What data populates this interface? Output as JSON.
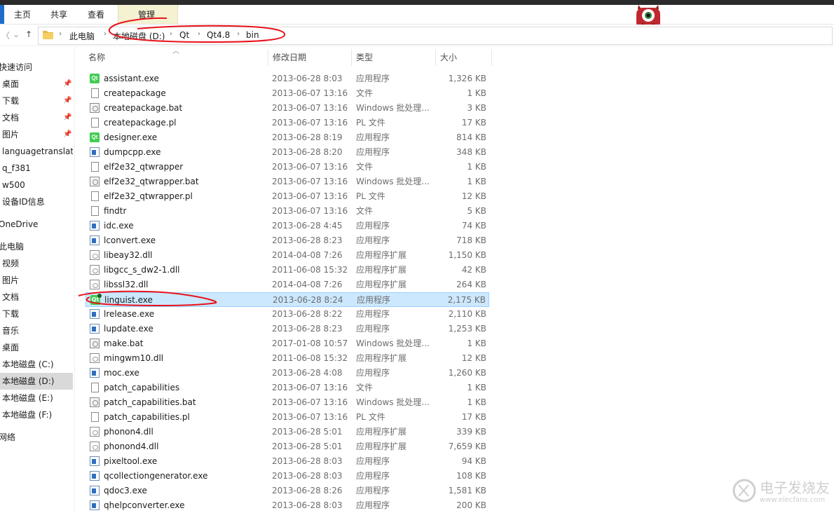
{
  "ribbon": {
    "tabs": [
      "主页",
      "共享",
      "查看"
    ],
    "context_tab": "管理"
  },
  "address": {
    "crumbs": [
      "此电脑",
      "本地磁盘 (D:)",
      "Qt",
      "Qt4.8",
      "bin"
    ]
  },
  "sidebar": {
    "items": [
      {
        "label": "快速访问",
        "pinned": false
      },
      {
        "label": "桌面",
        "pinned": true
      },
      {
        "label": "下载",
        "pinned": true
      },
      {
        "label": "文档",
        "pinned": true
      },
      {
        "label": "图片",
        "pinned": true
      },
      {
        "label": "languagetranslatc",
        "pinned": false
      },
      {
        "label": "q_f381",
        "pinned": false
      },
      {
        "label": "w500",
        "pinned": false
      },
      {
        "label": "设备ID信息",
        "pinned": false
      },
      {
        "label": "OneDrive",
        "pinned": false
      },
      {
        "label": "此电脑",
        "pinned": false
      },
      {
        "label": "视频",
        "pinned": false
      },
      {
        "label": "图片",
        "pinned": false
      },
      {
        "label": "文档",
        "pinned": false
      },
      {
        "label": "下载",
        "pinned": false
      },
      {
        "label": "音乐",
        "pinned": false
      },
      {
        "label": "桌面",
        "pinned": false
      },
      {
        "label": "本地磁盘 (C:)",
        "pinned": false
      },
      {
        "label": "本地磁盘 (D:)",
        "pinned": false,
        "selected": true
      },
      {
        "label": "本地磁盘 (E:)",
        "pinned": false
      },
      {
        "label": "本地磁盘 (F:)",
        "pinned": false
      },
      {
        "label": "网络",
        "pinned": false
      }
    ]
  },
  "columns": {
    "name": "名称",
    "date": "修改日期",
    "type": "类型",
    "size": "大小"
  },
  "files": [
    {
      "name": "assistant.exe",
      "date": "2013-06-28 8:03",
      "type": "应用程序",
      "size": "1,326 KB",
      "icon": "qt-icon"
    },
    {
      "name": "createpackage",
      "date": "2013-06-07 13:16",
      "type": "文件",
      "size": "1 KB",
      "icon": "file-icon"
    },
    {
      "name": "createpackage.bat",
      "date": "2013-06-07 13:16",
      "type": "Windows 批处理...",
      "size": "3 KB",
      "icon": "bat-icon"
    },
    {
      "name": "createpackage.pl",
      "date": "2013-06-07 13:16",
      "type": "PL 文件",
      "size": "17 KB",
      "icon": "file-icon"
    },
    {
      "name": "designer.exe",
      "date": "2013-06-28 8:19",
      "type": "应用程序",
      "size": "814 KB",
      "icon": "qt-icon"
    },
    {
      "name": "dumpcpp.exe",
      "date": "2013-06-28 8:20",
      "type": "应用程序",
      "size": "348 KB",
      "icon": "exe-icon"
    },
    {
      "name": "elf2e32_qtwrapper",
      "date": "2013-06-07 13:16",
      "type": "文件",
      "size": "1 KB",
      "icon": "file-icon"
    },
    {
      "name": "elf2e32_qtwrapper.bat",
      "date": "2013-06-07 13:16",
      "type": "Windows 批处理...",
      "size": "1 KB",
      "icon": "bat-icon"
    },
    {
      "name": "elf2e32_qtwrapper.pl",
      "date": "2013-06-07 13:16",
      "type": "PL 文件",
      "size": "12 KB",
      "icon": "file-icon"
    },
    {
      "name": "findtr",
      "date": "2013-06-07 13:16",
      "type": "文件",
      "size": "5 KB",
      "icon": "file-icon"
    },
    {
      "name": "idc.exe",
      "date": "2013-06-28 4:45",
      "type": "应用程序",
      "size": "74 KB",
      "icon": "exe-icon"
    },
    {
      "name": "lconvert.exe",
      "date": "2013-06-28 8:23",
      "type": "应用程序",
      "size": "718 KB",
      "icon": "exe-icon"
    },
    {
      "name": "libeay32.dll",
      "date": "2014-04-08 7:26",
      "type": "应用程序扩展",
      "size": "1,150 KB",
      "icon": "dll-icon"
    },
    {
      "name": "libgcc_s_dw2-1.dll",
      "date": "2011-06-08 15:32",
      "type": "应用程序扩展",
      "size": "42 KB",
      "icon": "dll-icon"
    },
    {
      "name": "libssl32.dll",
      "date": "2014-04-08 7:26",
      "type": "应用程序扩展",
      "size": "264 KB",
      "icon": "dll-icon"
    },
    {
      "name": "linguist.exe",
      "date": "2013-06-28 8:24",
      "type": "应用程序",
      "size": "2,175 KB",
      "icon": "linguist-icon",
      "selected": true
    },
    {
      "name": "lrelease.exe",
      "date": "2013-06-28 8:22",
      "type": "应用程序",
      "size": "2,110 KB",
      "icon": "exe-icon"
    },
    {
      "name": "lupdate.exe",
      "date": "2013-06-28 8:23",
      "type": "应用程序",
      "size": "1,253 KB",
      "icon": "exe-icon"
    },
    {
      "name": "make.bat",
      "date": "2017-01-08 10:57",
      "type": "Windows 批处理...",
      "size": "1 KB",
      "icon": "bat-icon"
    },
    {
      "name": "mingwm10.dll",
      "date": "2011-06-08 15:32",
      "type": "应用程序扩展",
      "size": "12 KB",
      "icon": "dll-icon"
    },
    {
      "name": "moc.exe",
      "date": "2013-06-28 4:08",
      "type": "应用程序",
      "size": "1,260 KB",
      "icon": "exe-icon"
    },
    {
      "name": "patch_capabilities",
      "date": "2013-06-07 13:16",
      "type": "文件",
      "size": "1 KB",
      "icon": "file-icon"
    },
    {
      "name": "patch_capabilities.bat",
      "date": "2013-06-07 13:16",
      "type": "Windows 批处理...",
      "size": "1 KB",
      "icon": "bat-icon"
    },
    {
      "name": "patch_capabilities.pl",
      "date": "2013-06-07 13:16",
      "type": "PL 文件",
      "size": "17 KB",
      "icon": "file-icon"
    },
    {
      "name": "phonon4.dll",
      "date": "2013-06-28 5:01",
      "type": "应用程序扩展",
      "size": "339 KB",
      "icon": "dll-icon"
    },
    {
      "name": "phonond4.dll",
      "date": "2013-06-28 5:01",
      "type": "应用程序扩展",
      "size": "7,659 KB",
      "icon": "dll-icon"
    },
    {
      "name": "pixeltool.exe",
      "date": "2013-06-28 8:03",
      "type": "应用程序",
      "size": "94 KB",
      "icon": "exe-icon"
    },
    {
      "name": "qcollectiongenerator.exe",
      "date": "2013-06-28 8:03",
      "type": "应用程序",
      "size": "108 KB",
      "icon": "exe-icon"
    },
    {
      "name": "qdoc3.exe",
      "date": "2013-06-28 8:26",
      "type": "应用程序",
      "size": "1,581 KB",
      "icon": "exe-icon"
    },
    {
      "name": "qhelpconverter.exe",
      "date": "2013-06-28 8:03",
      "type": "应用程序",
      "size": "200 KB",
      "icon": "exe-icon"
    }
  ],
  "watermark": {
    "title": "电子发烧友",
    "url": "www.elecfans.com"
  },
  "colors": {
    "selected_row": "#cce8ff",
    "annotation_red": "#e8131b",
    "qt_green": "#41cd52"
  }
}
